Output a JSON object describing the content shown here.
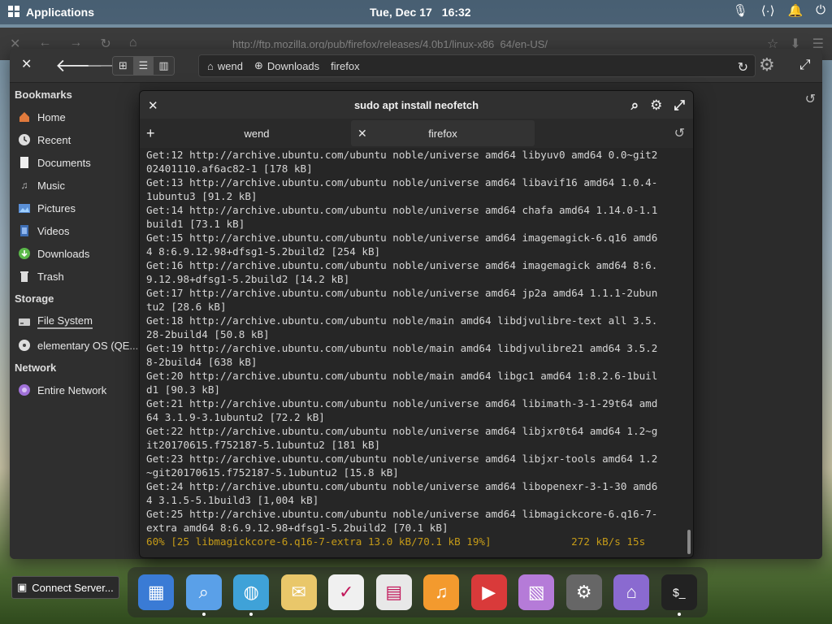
{
  "panel": {
    "apps_label": "Applications",
    "date": "Tue, Dec 17",
    "time": "16:32"
  },
  "firefox": {
    "url": "http://ftp.mozilla.org/pub/firefox/releases/4.0b1/linux-x86_64/en-US/"
  },
  "files": {
    "breadcrumbs": [
      "wend",
      "Downloads",
      "firefox"
    ],
    "bookmarks_title": "Bookmarks",
    "bookmarks": [
      {
        "label": "Home",
        "icon": "home-icon"
      },
      {
        "label": "Recent",
        "icon": "clock-icon"
      },
      {
        "label": "Documents",
        "icon": "document-icon"
      },
      {
        "label": "Music",
        "icon": "music-icon"
      },
      {
        "label": "Pictures",
        "icon": "picture-icon"
      },
      {
        "label": "Videos",
        "icon": "video-icon"
      },
      {
        "label": "Downloads",
        "icon": "download-icon"
      },
      {
        "label": "Trash",
        "icon": "trash-icon"
      }
    ],
    "storage_title": "Storage",
    "storage": [
      {
        "label": "File System",
        "icon": "drive-icon"
      },
      {
        "label": "elementary OS (QE...",
        "icon": "disc-icon"
      }
    ],
    "network_title": "Network",
    "network": [
      {
        "label": "Entire Network",
        "icon": "network-icon"
      }
    ]
  },
  "terminal": {
    "title": "sudo apt install neofetch",
    "tabs": [
      "wend",
      "firefox"
    ],
    "lines": [
      "Get:12 http://archive.ubuntu.com/ubuntu noble/universe amd64 libyuv0 amd64 0.0~git2",
      "02401110.af6ac82-1 [178 kB]",
      "Get:13 http://archive.ubuntu.com/ubuntu noble/universe amd64 libavif16 amd64 1.0.4-",
      "1ubuntu3 [91.2 kB]",
      "Get:14 http://archive.ubuntu.com/ubuntu noble/universe amd64 chafa amd64 1.14.0-1.1",
      "build1 [73.1 kB]",
      "Get:15 http://archive.ubuntu.com/ubuntu noble/universe amd64 imagemagick-6.q16 amd6",
      "4 8:6.9.12.98+dfsg1-5.2build2 [254 kB]",
      "Get:16 http://archive.ubuntu.com/ubuntu noble/universe amd64 imagemagick amd64 8:6.",
      "9.12.98+dfsg1-5.2build2 [14.2 kB]",
      "Get:17 http://archive.ubuntu.com/ubuntu noble/universe amd64 jp2a amd64 1.1.1-2ubun",
      "tu2 [28.6 kB]",
      "Get:18 http://archive.ubuntu.com/ubuntu noble/main amd64 libdjvulibre-text all 3.5.",
      "28-2build4 [50.8 kB]",
      "Get:19 http://archive.ubuntu.com/ubuntu noble/main amd64 libdjvulibre21 amd64 3.5.2",
      "8-2build4 [638 kB]",
      "Get:20 http://archive.ubuntu.com/ubuntu noble/main amd64 libgc1 amd64 1:8.2.6-1buil",
      "d1 [90.3 kB]",
      "Get:21 http://archive.ubuntu.com/ubuntu noble/universe amd64 libimath-3-1-29t64 amd",
      "64 3.1.9-3.1ubuntu2 [72.2 kB]",
      "Get:22 http://archive.ubuntu.com/ubuntu noble/universe amd64 libjxr0t64 amd64 1.2~g",
      "it20170615.f752187-5.1ubuntu2 [181 kB]",
      "Get:23 http://archive.ubuntu.com/ubuntu noble/universe amd64 libjxr-tools amd64 1.2",
      "~git20170615.f752187-5.1ubuntu2 [15.8 kB]",
      "Get:24 http://archive.ubuntu.com/ubuntu noble/universe amd64 libopenexr-3-1-30 amd6",
      "4 3.1.5-5.1build3 [1,004 kB]",
      "Get:25 http://archive.ubuntu.com/ubuntu noble/universe amd64 libmagickcore-6.q16-7-",
      "extra amd64 8:6.9.12.98+dfsg1-5.2build2 [70.1 kB]"
    ],
    "progress_line": "60% [25 libmagickcore-6.q16-7-extra 13.0 kB/70.1 kB 19%]             272 kB/s 15s"
  },
  "taskbar": {
    "connect_server_label": "Connect Server..."
  },
  "dock": [
    {
      "name": "multitasking-view",
      "icon": "multitasking-icon",
      "color": "#3a7bd5"
    },
    {
      "name": "files",
      "icon": "files-icon",
      "color": "#5aa0e8",
      "running": true
    },
    {
      "name": "web-browser",
      "icon": "browser-icon",
      "color": "#3fa2d8",
      "running": true
    },
    {
      "name": "mail",
      "icon": "mail-icon",
      "color": "#e9c76a"
    },
    {
      "name": "tasks",
      "icon": "tasks-icon",
      "color": "#f0f0f0"
    },
    {
      "name": "calendar",
      "icon": "calendar-icon",
      "color": "#e8e8e8"
    },
    {
      "name": "music",
      "icon": "music-icon",
      "color": "#f39a2e"
    },
    {
      "name": "videos",
      "icon": "videos-icon",
      "color": "#d93a3a"
    },
    {
      "name": "photos",
      "icon": "photos-icon",
      "color": "#b57bd8"
    },
    {
      "name": "settings",
      "icon": "settings-icon",
      "color": "#666666"
    },
    {
      "name": "appcenter",
      "icon": "store-icon",
      "color": "#8a6ad0"
    },
    {
      "name": "terminal",
      "icon": "terminal-icon",
      "color": "#222222",
      "running": true
    }
  ]
}
